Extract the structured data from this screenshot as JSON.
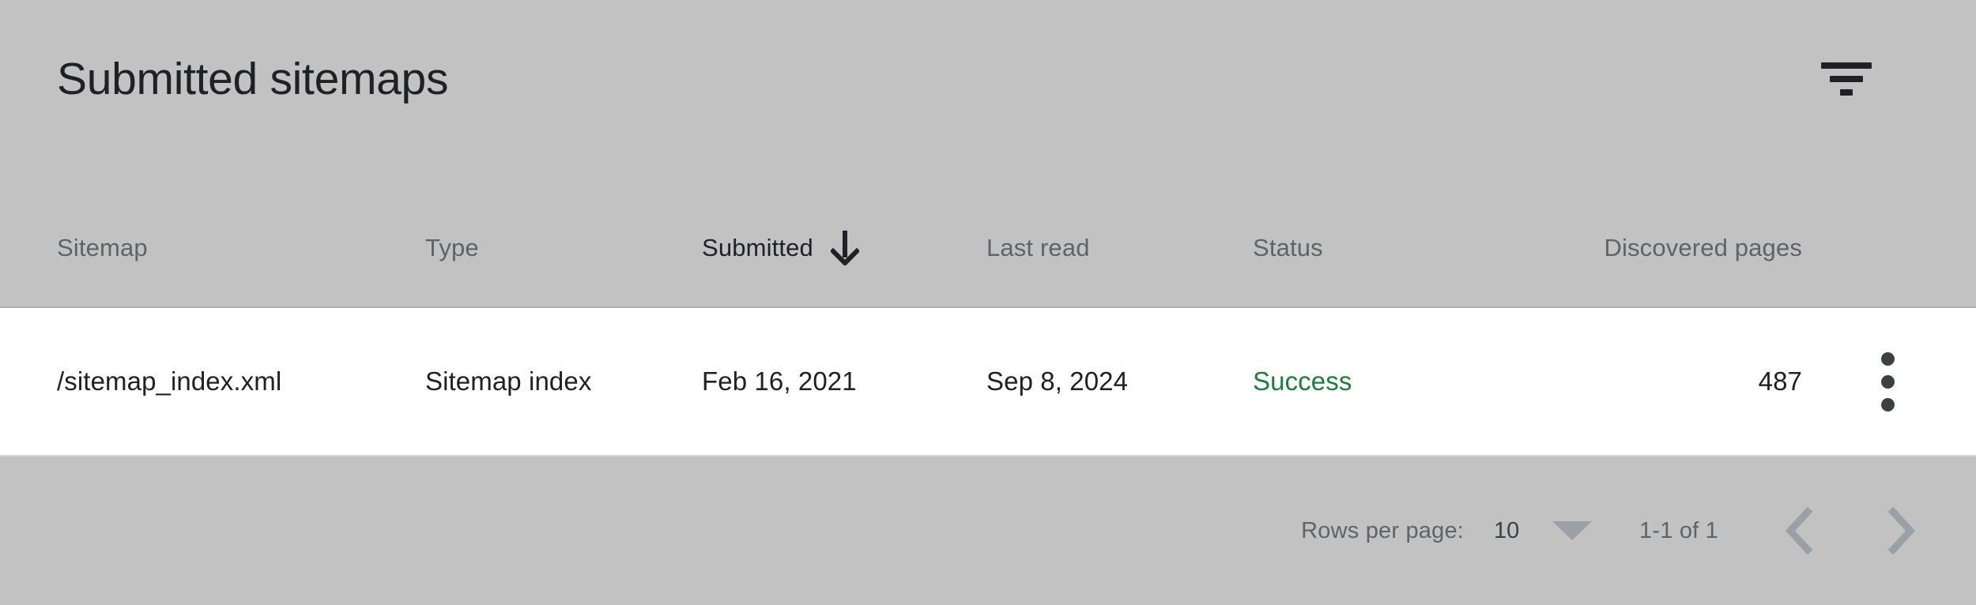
{
  "header": {
    "title": "Submitted sitemaps",
    "filter_icon": "filter-icon"
  },
  "table": {
    "columns": [
      {
        "key": "sitemap",
        "label": "Sitemap",
        "sorted": false,
        "align": "left"
      },
      {
        "key": "type",
        "label": "Type",
        "sorted": false,
        "align": "left"
      },
      {
        "key": "submitted",
        "label": "Submitted",
        "sorted": true,
        "align": "left",
        "sort_direction_icon": "arrow-down-icon"
      },
      {
        "key": "lastread",
        "label": "Last read",
        "sorted": false,
        "align": "left"
      },
      {
        "key": "status",
        "label": "Status",
        "sorted": false,
        "align": "left"
      },
      {
        "key": "pages",
        "label": "Discovered pages",
        "sorted": false,
        "align": "right"
      }
    ],
    "rows": [
      {
        "sitemap": "/sitemap_index.xml",
        "type": "Sitemap index",
        "submitted": "Feb 16, 2021",
        "lastread": "Sep 8, 2024",
        "status": "Success",
        "status_color": "#188038",
        "pages": "487",
        "row_menu_icon": "more-vert-icon"
      }
    ]
  },
  "pagination": {
    "rows_per_page_label": "Rows per page:",
    "rows_per_page_value": "10",
    "rows_per_page_caret_icon": "chevron-down-icon",
    "range_label": "1-1 of 1",
    "prev_icon": "chevron-left-icon",
    "next_icon": "chevron-right-icon"
  },
  "colors": {
    "background": "#c2c2c2",
    "row_background": "#ffffff",
    "text_primary": "#202124",
    "text_secondary": "#5f6368",
    "success_green": "#188038",
    "icon_muted": "#9aa0a6"
  }
}
